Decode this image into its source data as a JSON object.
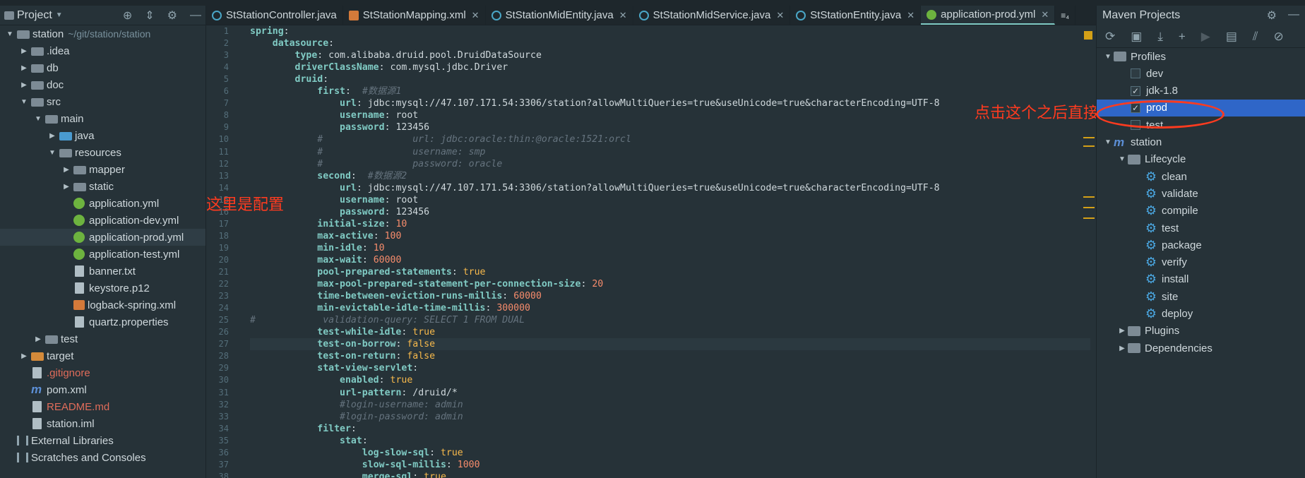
{
  "project_panel": {
    "title": "Project",
    "tree": [
      {
        "label": "station",
        "extra": "~/git/station/station",
        "indent": 0,
        "arrow": "down",
        "icon": "folder-icon"
      },
      {
        "label": ".idea",
        "indent": 1,
        "arrow": "right",
        "icon": "folder-icon"
      },
      {
        "label": "db",
        "indent": 1,
        "arrow": "right",
        "icon": "folder-icon"
      },
      {
        "label": "doc",
        "indent": 1,
        "arrow": "right",
        "icon": "folder-icon"
      },
      {
        "label": "src",
        "indent": 1,
        "arrow": "down",
        "icon": "folder-icon"
      },
      {
        "label": "main",
        "indent": 2,
        "arrow": "down",
        "icon": "folder-icon"
      },
      {
        "label": "java",
        "indent": 3,
        "arrow": "right",
        "icon": "source-folder-icon"
      },
      {
        "label": "resources",
        "indent": 3,
        "arrow": "down",
        "icon": "resources-folder-icon"
      },
      {
        "label": "mapper",
        "indent": 4,
        "arrow": "right",
        "icon": "folder-icon"
      },
      {
        "label": "static",
        "indent": 4,
        "arrow": "right",
        "icon": "folder-icon"
      },
      {
        "label": "application.yml",
        "indent": 4,
        "arrow": "none",
        "icon": "spring-icon"
      },
      {
        "label": "application-dev.yml",
        "indent": 4,
        "arrow": "none",
        "icon": "spring-icon"
      },
      {
        "label": "application-prod.yml",
        "indent": 4,
        "arrow": "none",
        "icon": "spring-icon",
        "selected": true
      },
      {
        "label": "application-test.yml",
        "indent": 4,
        "arrow": "none",
        "icon": "spring-icon"
      },
      {
        "label": "banner.txt",
        "indent": 4,
        "arrow": "none",
        "icon": "text-file-icon"
      },
      {
        "label": "keystore.p12",
        "indent": 4,
        "arrow": "none",
        "icon": "file-icon"
      },
      {
        "label": "logback-spring.xml",
        "indent": 4,
        "arrow": "none",
        "icon": "xml-file-icon"
      },
      {
        "label": "quartz.properties",
        "indent": 4,
        "arrow": "none",
        "icon": "properties-file-icon"
      },
      {
        "label": "test",
        "indent": 2,
        "arrow": "right",
        "icon": "folder-icon"
      },
      {
        "label": "target",
        "indent": 1,
        "arrow": "right",
        "icon": "excluded-folder-icon"
      },
      {
        "label": ".gitignore",
        "indent": 1,
        "arrow": "none",
        "icon": "file-icon",
        "red": true
      },
      {
        "label": "pom.xml",
        "indent": 1,
        "arrow": "none",
        "icon": "maven-icon"
      },
      {
        "label": "README.md",
        "indent": 1,
        "arrow": "none",
        "icon": "markdown-icon",
        "red": true
      },
      {
        "label": "station.iml",
        "indent": 1,
        "arrow": "none",
        "icon": "module-file-icon"
      },
      {
        "label": "External Libraries",
        "indent": 0,
        "arrow": "none",
        "icon": "libraries-icon"
      },
      {
        "label": "Scratches and Consoles",
        "indent": 0,
        "arrow": "none",
        "icon": "scratches-icon"
      }
    ]
  },
  "tabs": [
    {
      "label": "StStationController.java",
      "icon": "class",
      "close": false
    },
    {
      "label": "StStationMapping.xml",
      "icon": "xml",
      "close": true
    },
    {
      "label": "StStationMidEntity.java",
      "icon": "class",
      "close": true
    },
    {
      "label": "StStationMidService.java",
      "icon": "class",
      "close": true
    },
    {
      "label": "StStationEntity.java",
      "icon": "class",
      "close": true
    },
    {
      "label": "application-prod.yml",
      "icon": "spring",
      "close": true,
      "active": true
    }
  ],
  "tabs_overflow": "≡₄",
  "editor": {
    "lines": [
      [
        [
          "k",
          "spring"
        ],
        [
          "v",
          ":"
        ]
      ],
      [
        [
          "v",
          "    "
        ],
        [
          "k",
          "datasource"
        ],
        [
          "v",
          ":"
        ]
      ],
      [
        [
          "v",
          "        "
        ],
        [
          "k",
          "type"
        ],
        [
          "v",
          ": com.alibaba.druid.pool.DruidDataSource"
        ]
      ],
      [
        [
          "v",
          "        "
        ],
        [
          "k",
          "driverClassName"
        ],
        [
          "v",
          ": com.mysql.jdbc.Driver"
        ]
      ],
      [
        [
          "v",
          "        "
        ],
        [
          "k",
          "druid"
        ],
        [
          "v",
          ":"
        ]
      ],
      [
        [
          "v",
          "            "
        ],
        [
          "k",
          "first"
        ],
        [
          "v",
          ":  "
        ],
        [
          "c",
          "#数据源1"
        ]
      ],
      [
        [
          "v",
          "                "
        ],
        [
          "k",
          "url"
        ],
        [
          "v",
          ": jdbc:mysql://47.107.171.54:3306/station?allowMultiQueries=true&useUnicode=true&characterEncoding=UTF-8"
        ]
      ],
      [
        [
          "v",
          "                "
        ],
        [
          "k",
          "username"
        ],
        [
          "v",
          ": root"
        ]
      ],
      [
        [
          "v",
          "                "
        ],
        [
          "k",
          "password"
        ],
        [
          "v",
          ": 123456"
        ]
      ],
      [
        [
          "c",
          "            #                url: jdbc:oracle:thin:@oracle:1521:orcl"
        ]
      ],
      [
        [
          "c",
          "            #                username: smp"
        ]
      ],
      [
        [
          "c",
          "            #                password: oracle"
        ]
      ],
      [
        [
          "v",
          "            "
        ],
        [
          "k",
          "second"
        ],
        [
          "v",
          ":  "
        ],
        [
          "c",
          "#数据源2"
        ]
      ],
      [
        [
          "v",
          "                "
        ],
        [
          "k",
          "url"
        ],
        [
          "v",
          ": jdbc:mysql://47.107.171.54:3306/station?allowMultiQueries=true&useUnicode=true&characterEncoding=UTF-8"
        ]
      ],
      [
        [
          "v",
          "                "
        ],
        [
          "k",
          "username"
        ],
        [
          "v",
          ": root"
        ]
      ],
      [
        [
          "v",
          "                "
        ],
        [
          "k",
          "password"
        ],
        [
          "v",
          ": 123456"
        ]
      ],
      [
        [
          "v",
          "            "
        ],
        [
          "k",
          "initial-size"
        ],
        [
          "v",
          ": "
        ],
        [
          "n",
          "10"
        ]
      ],
      [
        [
          "v",
          "            "
        ],
        [
          "k",
          "max-active"
        ],
        [
          "v",
          ": "
        ],
        [
          "n",
          "100"
        ]
      ],
      [
        [
          "v",
          "            "
        ],
        [
          "k",
          "min-idle"
        ],
        [
          "v",
          ": "
        ],
        [
          "n",
          "10"
        ]
      ],
      [
        [
          "v",
          "            "
        ],
        [
          "k",
          "max-wait"
        ],
        [
          "v",
          ": "
        ],
        [
          "n",
          "60000"
        ]
      ],
      [
        [
          "v",
          "            "
        ],
        [
          "k",
          "pool-prepared-statements"
        ],
        [
          "v",
          ": "
        ],
        [
          "b",
          "true"
        ]
      ],
      [
        [
          "v",
          "            "
        ],
        [
          "k",
          "max-pool-prepared-statement-per-connection-size"
        ],
        [
          "v",
          ": "
        ],
        [
          "n",
          "20"
        ]
      ],
      [
        [
          "v",
          "            "
        ],
        [
          "k",
          "time-between-eviction-runs-millis"
        ],
        [
          "v",
          ": "
        ],
        [
          "n",
          "60000"
        ]
      ],
      [
        [
          "v",
          "            "
        ],
        [
          "k",
          "min-evictable-idle-time-millis"
        ],
        [
          "v",
          ": "
        ],
        [
          "n",
          "300000"
        ]
      ],
      [
        [
          "c",
          "#            validation-query: SELECT 1 FROM DUAL"
        ]
      ],
      [
        [
          "v",
          "            "
        ],
        [
          "k",
          "test-while-idle"
        ],
        [
          "v",
          ": "
        ],
        [
          "b",
          "true"
        ]
      ],
      [
        [
          "v",
          "            "
        ],
        [
          "k",
          "test-on-borrow"
        ],
        [
          "v",
          ": "
        ],
        [
          "b",
          "false"
        ]
      ],
      [
        [
          "v",
          "            "
        ],
        [
          "k",
          "test-on-return"
        ],
        [
          "v",
          ": "
        ],
        [
          "b",
          "false"
        ]
      ],
      [
        [
          "v",
          "            "
        ],
        [
          "k",
          "stat-view-servlet"
        ],
        [
          "v",
          ":"
        ]
      ],
      [
        [
          "v",
          "                "
        ],
        [
          "k",
          "enabled"
        ],
        [
          "v",
          ": "
        ],
        [
          "b",
          "true"
        ]
      ],
      [
        [
          "v",
          "                "
        ],
        [
          "k",
          "url-pattern"
        ],
        [
          "v",
          ": /druid/*"
        ]
      ],
      [
        [
          "v",
          "                "
        ],
        [
          "c",
          "#login-username: admin"
        ]
      ],
      [
        [
          "v",
          "                "
        ],
        [
          "c",
          "#login-password: admin"
        ]
      ],
      [
        [
          "v",
          "            "
        ],
        [
          "k",
          "filter"
        ],
        [
          "v",
          ":"
        ]
      ],
      [
        [
          "v",
          "                "
        ],
        [
          "k",
          "stat"
        ],
        [
          "v",
          ":"
        ]
      ],
      [
        [
          "v",
          "                    "
        ],
        [
          "k",
          "log-slow-sql"
        ],
        [
          "v",
          ": "
        ],
        [
          "b",
          "true"
        ]
      ],
      [
        [
          "v",
          "                    "
        ],
        [
          "k",
          "slow-sql-millis"
        ],
        [
          "v",
          ": "
        ],
        [
          "n",
          "1000"
        ]
      ],
      [
        [
          "v",
          "                    "
        ],
        [
          "k",
          "merge-sql"
        ],
        [
          "v",
          ": "
        ],
        [
          "b",
          "true"
        ]
      ]
    ],
    "highlight_line": 27
  },
  "annotations": {
    "left_note": "这里是配置",
    "right_note": "点击这个之后直接启动"
  },
  "maven_panel": {
    "title": "Maven Projects",
    "profiles_label": "Profiles",
    "profiles": [
      {
        "label": "dev",
        "checked": false
      },
      {
        "label": "jdk-1.8",
        "checked": true
      },
      {
        "label": "prod",
        "checked": true,
        "selected": true
      },
      {
        "label": "test",
        "checked": false
      }
    ],
    "project_label": "station",
    "lifecycle_label": "Lifecycle",
    "lifecycle": [
      "clean",
      "validate",
      "compile",
      "test",
      "package",
      "verify",
      "install",
      "site",
      "deploy"
    ],
    "plugins_label": "Plugins",
    "dependencies_label": "Dependencies"
  },
  "colors": {
    "background": "#263238",
    "selection": "#2f66c8",
    "annotation": "#ff3b1f",
    "key": "#80cbc4",
    "number": "#f78c6c",
    "boolean": "#f7b94b"
  }
}
